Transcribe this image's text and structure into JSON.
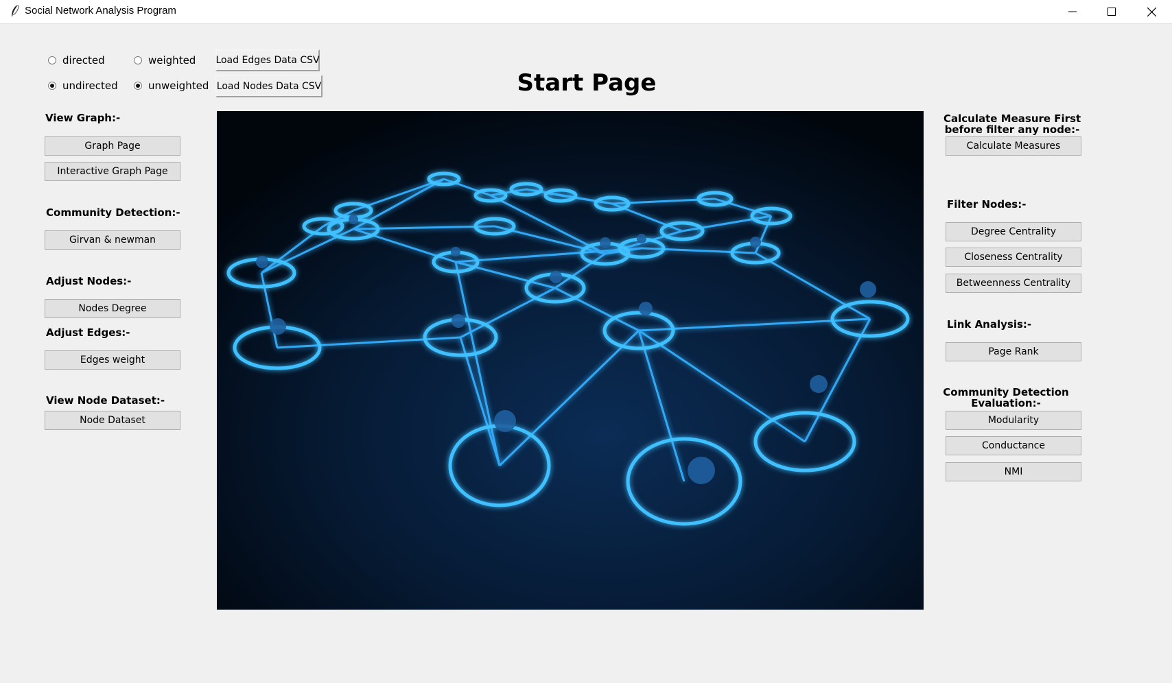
{
  "window": {
    "title": "Social Network Analysis Program",
    "icons": {
      "app": "feather-icon",
      "minimize": "minimize-icon",
      "maximize": "maximize-icon",
      "close": "close-icon"
    }
  },
  "options": {
    "directed": {
      "label": "directed",
      "checked": false
    },
    "undirected": {
      "label": "undirected",
      "checked": true
    },
    "weighted": {
      "label": "weighted",
      "checked": false
    },
    "unweighted": {
      "label": "unweighted",
      "checked": true
    }
  },
  "load": {
    "edges_label": "Load Edges Data CSV",
    "nodes_label": "Load Nodes Data CSV"
  },
  "page_title": "Start Page",
  "left": {
    "view_graph_heading": "View Graph:-",
    "graph_page": "Graph Page",
    "interactive_graph_page": "Interactive Graph Page",
    "community_heading": "Community Detection:-",
    "girvan": "Girvan & newman",
    "adjust_nodes_heading": "Adjust Nodes:-",
    "nodes_degree": "Nodes Degree",
    "adjust_edges_heading": "Adjust Edges:-",
    "edges_weight": "Edges weight",
    "view_node_dataset_heading": "View Node Dataset:-",
    "node_dataset": "Node Dataset"
  },
  "right": {
    "calc_heading_line1": "Calculate Measure First",
    "calc_heading_line2": "before filter any node:-",
    "calculate_measures": "Calculate Measures",
    "filter_heading": "Filter Nodes:-",
    "degree": "Degree Centrality",
    "closeness": "Closeness Centrality",
    "betweenness": "Betweenness Centrality",
    "link_heading": "Link Analysis:-",
    "page_rank": "Page Rank",
    "eval_heading_line1": "Community Detection",
    "eval_heading_line2": "Evaluation:-",
    "modularity": "Modularity",
    "conductance": "Conductance",
    "nmi": "NMI"
  },
  "colors": {
    "glow": "#2aa6ff",
    "panel_bg": "#020b18",
    "window_bg": "#f0f0f0"
  }
}
